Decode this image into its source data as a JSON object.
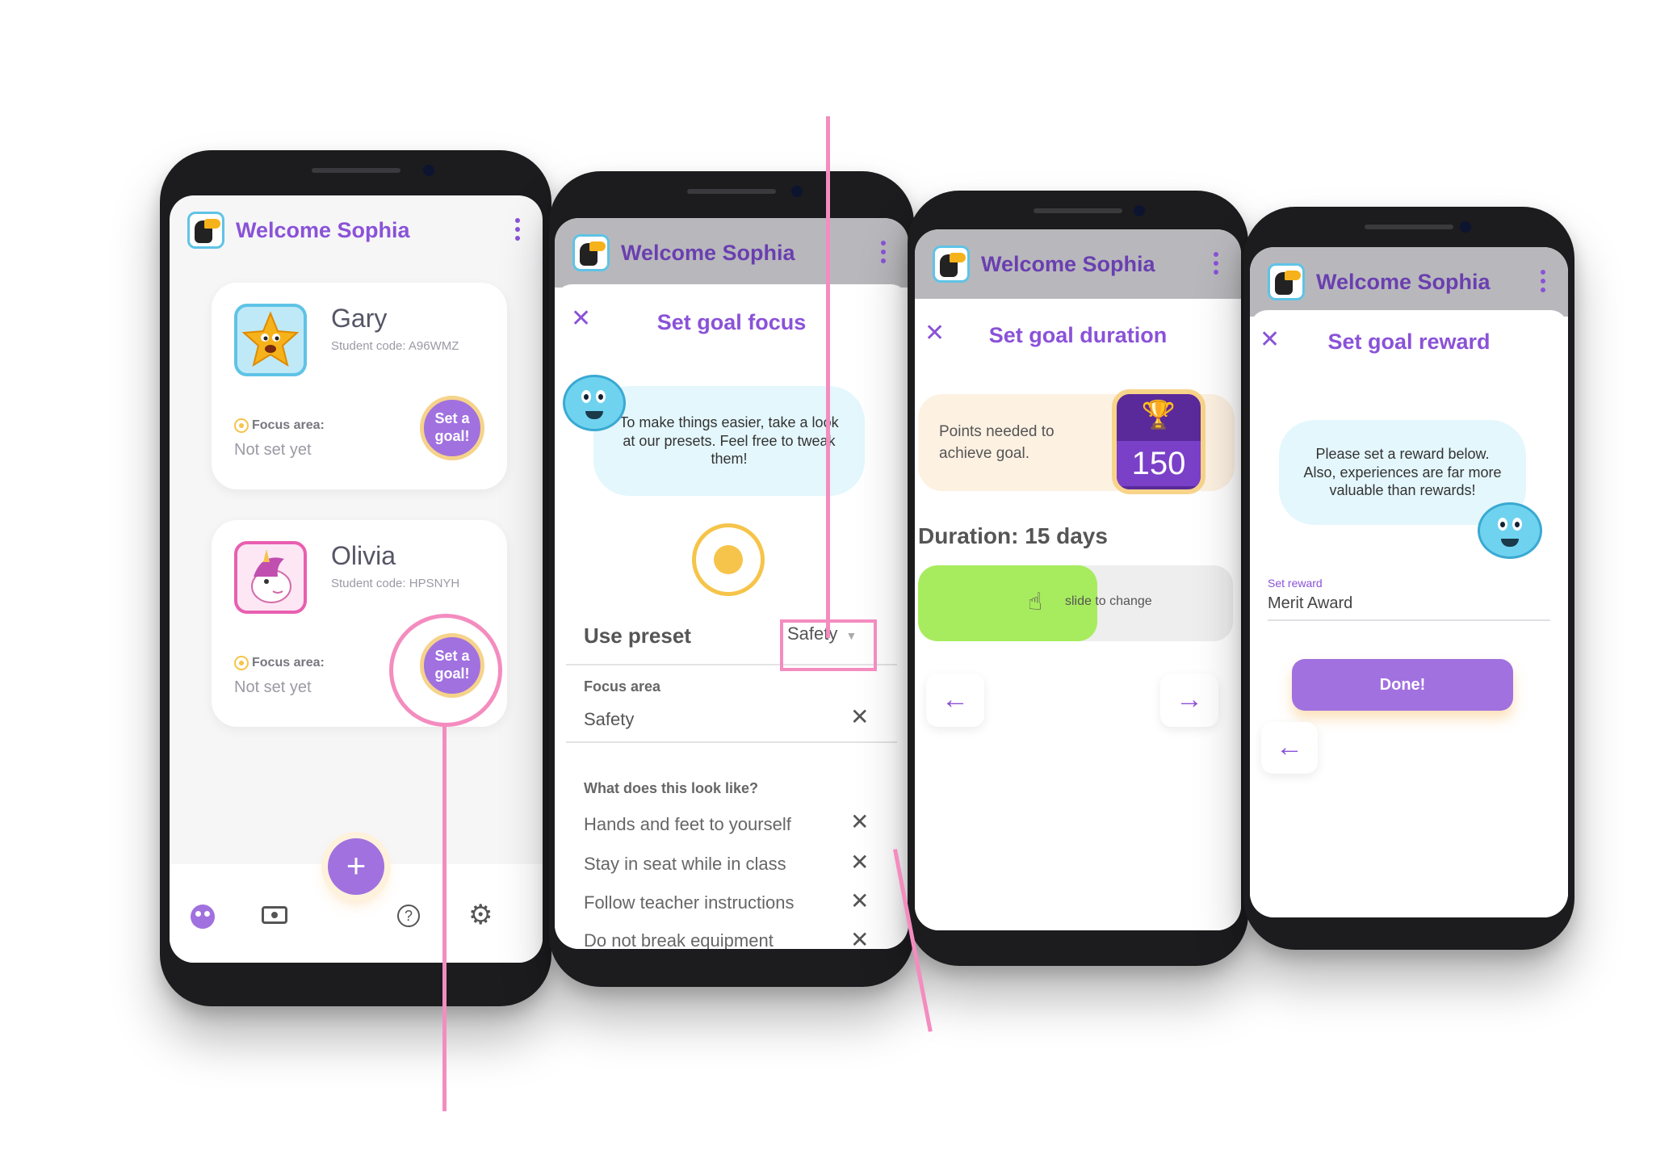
{
  "app": {
    "welcome_title": "Welcome Sophia"
  },
  "screen1": {
    "students": [
      {
        "name": "Gary",
        "code": "Student code: A96WMZ",
        "focus_label": "Focus area:",
        "focus_value": "Not set yet",
        "goal_button": "Set a goal!"
      },
      {
        "name": "Olivia",
        "code": "Student code: HPSNYH",
        "focus_label": "Focus area:",
        "focus_value": "Not set yet",
        "goal_button": "Set a goal!"
      }
    ],
    "fab_label": "+",
    "nav_icons": [
      "students-icon",
      "screen-icon",
      "help-icon",
      "settings-icon"
    ]
  },
  "screen2": {
    "title": "Set goal focus",
    "bubble_text": "To make things easier, take a look at our presets. Feel free to tweak them!",
    "use_preset_label": "Use preset",
    "preset_value": "Safety",
    "focus_area_label": "Focus area",
    "focus_area_value": "Safety",
    "looks_like_label": "What does this look like?",
    "behaviours": [
      "Hands and feet to yourself",
      "Stay in seat while in class",
      "Follow teacher instructions",
      "Do not break equipment"
    ]
  },
  "screen3": {
    "title": "Set goal duration",
    "points_label": "Points needed to achieve goal.",
    "points_value": "150",
    "duration_label": "Duration: 15 days",
    "slider_hint": "slide to change",
    "slider_fill_fraction": 0.57
  },
  "screen4": {
    "title": "Set goal reward",
    "bubble_text": "Please set a reward below. Also, experiences are far more valuable than rewards!",
    "reward_label": "Set reward",
    "reward_value": "Merit Award",
    "done_button": "Done!"
  },
  "colors": {
    "brand_purple": "#8a52d8",
    "button_purple": "#a171df",
    "highlight_pink": "#f48cbf",
    "slider_green": "#a7ec5e",
    "bubble_blue": "#e4f7fc"
  }
}
